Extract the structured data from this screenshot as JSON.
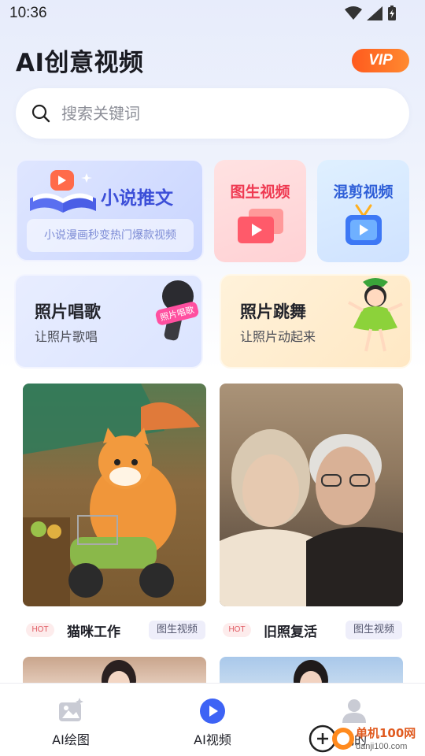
{
  "status_bar": {
    "time": "10:36"
  },
  "header": {
    "title": "AI创意视频",
    "vip_label": "VIP"
  },
  "search": {
    "placeholder": "搜索关键词"
  },
  "features": {
    "novel": {
      "title": "小说推文",
      "subtitle": "小说漫画秒变热门爆款视频"
    },
    "img2video": {
      "title": "图生视频"
    },
    "mix": {
      "title": "混剪视频"
    },
    "sing": {
      "title": "照片唱歌",
      "subtitle": "让照片歌唱",
      "badge": "照片唱歌"
    },
    "dance": {
      "title": "照片跳舞",
      "subtitle": "让照片动起来"
    }
  },
  "templates": [
    {
      "hot": "HOT",
      "name": "猫咪工作",
      "tag": "图生视频"
    },
    {
      "hot": "HOT",
      "name": "旧照复活",
      "tag": "图生视频"
    }
  ],
  "bottom_nav": [
    {
      "label": "AI绘图"
    },
    {
      "label": "AI视频"
    },
    {
      "label": "我的"
    }
  ],
  "watermark": {
    "text": "单机100网",
    "url": "danji100.com"
  },
  "colors": {
    "accent": "#3b5bdb",
    "vip": "#ff6a24",
    "play": "#3d63f5"
  }
}
